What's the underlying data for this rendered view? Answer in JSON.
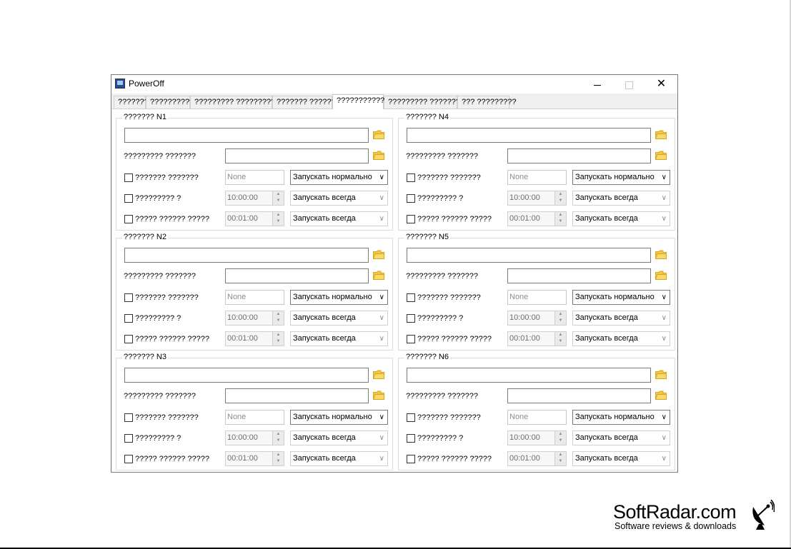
{
  "window": {
    "title": "PowerOff",
    "minimize_label": "",
    "close_label": "✕"
  },
  "tabs": [
    {
      "label": "???????"
    },
    {
      "label": "??????????"
    },
    {
      "label": "????????? ???????????"
    },
    {
      "label": "??????? ???????"
    },
    {
      "label": "???????????"
    },
    {
      "label": "????????? ?????????"
    },
    {
      "label": "??? ?????????"
    }
  ],
  "groups": [
    {
      "title": "??????? N1",
      "params_label": "????????? ???????",
      "none_label": "??????? ???????",
      "time_label": "????????? ?",
      "interval_label": "????? ?????? ?????",
      "none_value": "None",
      "mode_value": "Запускать нормально",
      "time_value": "10:00:00",
      "time_mode": "Запускать всегда",
      "interval_value": "00:01:00",
      "interval_mode": "Запускать всегда"
    },
    {
      "title": "??????? N4",
      "params_label": "????????? ???????",
      "none_label": "??????? ???????",
      "time_label": "????????? ?",
      "interval_label": "????? ?????? ?????",
      "none_value": "None",
      "mode_value": "Запускать нормально",
      "time_value": "10:00:00",
      "time_mode": "Запускать всегда",
      "interval_value": "00:01:00",
      "interval_mode": "Запускать всегда"
    },
    {
      "title": "??????? N2",
      "params_label": "????????? ???????",
      "none_label": "??????? ???????",
      "time_label": "????????? ?",
      "interval_label": "????? ?????? ?????",
      "none_value": "None",
      "mode_value": "Запускать нормально",
      "time_value": "10:00:00",
      "time_mode": "Запускать всегда",
      "interval_value": "00:01:00",
      "interval_mode": "Запускать всегда"
    },
    {
      "title": "??????? N5",
      "params_label": "????????? ???????",
      "none_label": "??????? ???????",
      "time_label": "????????? ?",
      "interval_label": "????? ?????? ?????",
      "none_value": "None",
      "mode_value": "Запускать нормально",
      "time_value": "10:00:00",
      "time_mode": "Запускать всегда",
      "interval_value": "00:01:00",
      "interval_mode": "Запускать всегда"
    },
    {
      "title": "??????? N3",
      "params_label": "????????? ???????",
      "none_label": "??????? ???????",
      "time_label": "????????? ?",
      "interval_label": "????? ?????? ?????",
      "none_value": "None",
      "mode_value": "Запускать нормально",
      "time_value": "10:00:00",
      "time_mode": "Запускать всегда",
      "interval_value": "00:01:00",
      "interval_mode": "Запускать всегда"
    },
    {
      "title": "??????? N6",
      "params_label": "????????? ???????",
      "none_label": "??????? ???????",
      "time_label": "????????? ?",
      "interval_label": "????? ?????? ?????",
      "none_value": "None",
      "mode_value": "Запускать нормально",
      "time_value": "10:00:00",
      "time_mode": "Запускать всегда",
      "interval_value": "00:01:00",
      "interval_mode": "Запускать всегда"
    }
  ],
  "watermark": {
    "name": "SoftRadar.com",
    "tagline": "Software reviews & downloads"
  },
  "colors": {
    "folder": "#f2c744",
    "folder_dark": "#d9a520"
  }
}
